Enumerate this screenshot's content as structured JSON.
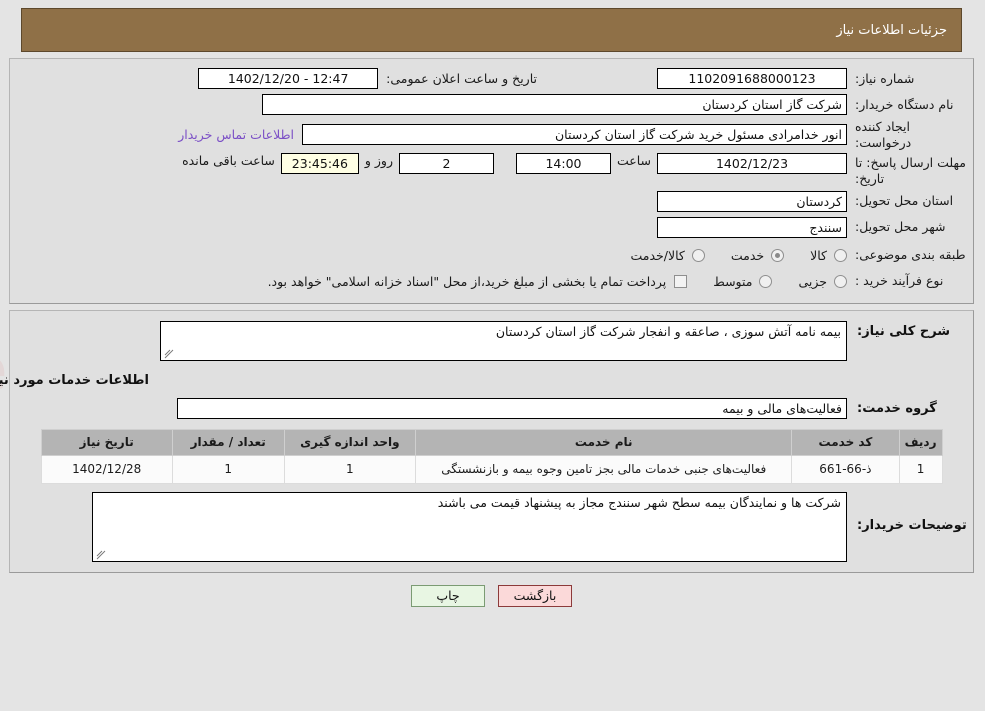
{
  "header": {
    "title": "جزئیات اطلاعات نیاز"
  },
  "colors": {
    "header_bg": "#8f7047",
    "panel_bg": "#e0e0e0",
    "page_bg": "#e4e4e4",
    "link": "#7b4fc6",
    "countdown_bg": "#ffffe4",
    "table_header_bg": "#b4b4b4",
    "btn_back_bg": "#fbd9d9",
    "btn_print_bg": "#e8f6e3"
  },
  "top_form": {
    "need_number_label": "شماره نیاز:",
    "need_number_value": "1102091688000123",
    "announce_label": "تاریخ و ساعت اعلان عمومی:",
    "announce_value": "12:47 - 1402/12/20",
    "buyer_org_label": "نام دستگاه خریدار:",
    "buyer_org_value": "شرکت گاز استان کردستان",
    "creator_label": "ایجاد کننده درخواست:",
    "creator_value": "انور خدامرادی مسئول خرید  شرکت گاز استان کردستان",
    "contact_link": "اطلاعات تماس خریدار",
    "deadline_label_line1": "مهلت ارسال پاسخ: تا",
    "deadline_label_line2": "تاریخ:",
    "deadline_date": "1402/12/23",
    "deadline_hour_label": "ساعت",
    "deadline_hour": "14:00",
    "remaining_days": "2",
    "remaining_days_label": "روز و",
    "remaining_time": "23:45:46",
    "remaining_time_label": "ساعت باقی مانده",
    "province_label": "استان محل تحویل:",
    "province_value": "کردستان",
    "city_label": "شهر محل تحویل:",
    "city_value": "سنندج",
    "category_label": "طبقه بندی موضوعی:",
    "category_options": [
      {
        "label": "کالا",
        "selected": false
      },
      {
        "label": "خدمت",
        "selected": true
      },
      {
        "label": "کالا/خدمت",
        "selected": false
      }
    ],
    "process_label": "نوع فرآیند خرید :",
    "process_options": [
      {
        "label": "جزیی",
        "selected": false
      },
      {
        "label": "متوسط",
        "selected": false
      }
    ],
    "treasury_checkbox_checked": false,
    "treasury_text": "پرداخت تمام یا بخشی از مبلغ خرید،از محل \"اسناد خزانه اسلامی\" خواهد بود."
  },
  "description": {
    "label": "شرح کلی نیاز:",
    "value": "بیمه نامه آتش سوزی ، صاعقه و انفجار شرکت گاز استان کردستان"
  },
  "services_section": {
    "title": "اطلاعات خدمات مورد نیاز",
    "group_label": "گروه خدمت:",
    "group_value": "فعالیت‌های مالی و بیمه"
  },
  "items_table": {
    "columns": [
      "ردیف",
      "کد خدمت",
      "نام خدمت",
      "واحد اندازه گیری",
      "تعداد / مقدار",
      "تاریخ نیاز"
    ],
    "rows": [
      {
        "index": "1",
        "code": "ذ-66-661",
        "name": "فعالیت‌های جنبی خدمات مالی بجز تامین وجوه بیمه و بازنشستگی",
        "unit": "1",
        "quantity": "1",
        "need_date": "1402/12/28"
      }
    ]
  },
  "buyer_remarks": {
    "label": "توضیحات خریدار:",
    "value": "شرکت ها و نمایندگان بیمه سطح شهر سنندج مجاز به پیشنهاد قیمت می باشند"
  },
  "footer": {
    "back_label": "بازگشت",
    "print_label": "چاپ"
  }
}
